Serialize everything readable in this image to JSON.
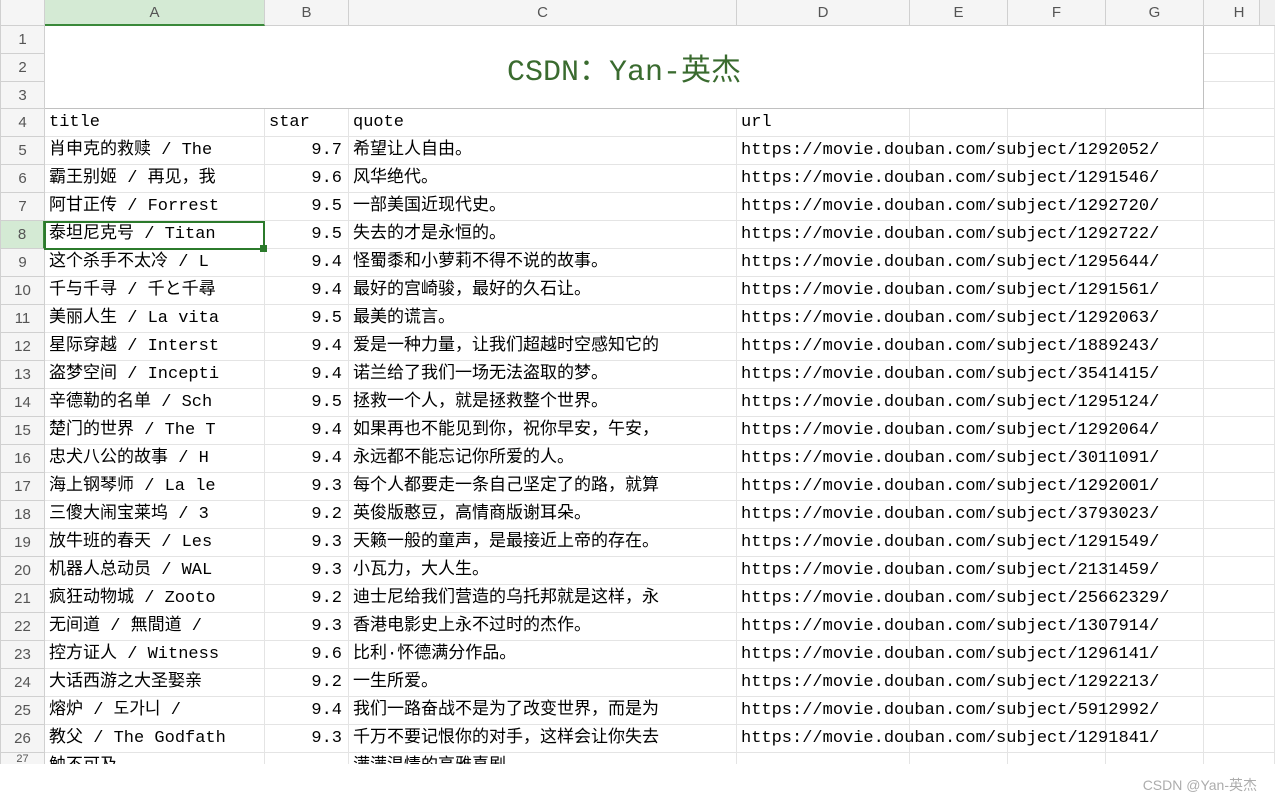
{
  "columns": [
    "A",
    "B",
    "C",
    "D",
    "E",
    "F",
    "G",
    "H"
  ],
  "title_cell": "CSDN：Yan-英杰",
  "header_row": {
    "A": "title",
    "B": "star",
    "C": "quote",
    "D": "url"
  },
  "selected_cell": "A8",
  "watermark": "CSDN @Yan-英杰",
  "chart_data": {
    "type": "table",
    "columns": [
      "title",
      "star",
      "quote",
      "url"
    ],
    "rows": [
      {
        "title": "肖申克的救赎  /  The",
        "star": 9.7,
        "quote": "希望让人自由。",
        "url": "https://movie.douban.com/subject/1292052/"
      },
      {
        "title": "霸王别姬  /  再见，我",
        "star": 9.6,
        "quote": "风华绝代。",
        "url": "https://movie.douban.com/subject/1291546/"
      },
      {
        "title": "阿甘正传  /  Forrest",
        "star": 9.5,
        "quote": "一部美国近现代史。",
        "url": "https://movie.douban.com/subject/1292720/"
      },
      {
        "title": "泰坦尼克号  /  Titan",
        "star": 9.5,
        "quote": "失去的才是永恒的。",
        "url": "https://movie.douban.com/subject/1292722/"
      },
      {
        "title": "这个杀手不太冷  /  L",
        "star": 9.4,
        "quote": "怪蜀黍和小萝莉不得不说的故事。",
        "url": "https://movie.douban.com/subject/1295644/"
      },
      {
        "title": "千与千寻  /  千と千尋",
        "star": 9.4,
        "quote": "最好的宫崎骏，最好的久石让。",
        "url": "https://movie.douban.com/subject/1291561/"
      },
      {
        "title": "美丽人生  /  La vita",
        "star": 9.5,
        "quote": "最美的谎言。",
        "url": "https://movie.douban.com/subject/1292063/"
      },
      {
        "title": "星际穿越  /  Interst",
        "star": 9.4,
        "quote": "爱是一种力量，让我们超越时空感知它的",
        "url": "https://movie.douban.com/subject/1889243/"
      },
      {
        "title": "盗梦空间  /  Incepti",
        "star": 9.4,
        "quote": "诺兰给了我们一场无法盗取的梦。",
        "url": "https://movie.douban.com/subject/3541415/"
      },
      {
        "title": "辛德勒的名单  /  Sch",
        "star": 9.5,
        "quote": "拯救一个人，就是拯救整个世界。",
        "url": "https://movie.douban.com/subject/1295124/"
      },
      {
        "title": "楚门的世界  /  The T",
        "star": 9.4,
        "quote": "如果再也不能见到你，祝你早安，午安，",
        "url": "https://movie.douban.com/subject/1292064/"
      },
      {
        "title": "忠犬八公的故事  /  H",
        "star": 9.4,
        "quote": "永远都不能忘记你所爱的人。",
        "url": "https://movie.douban.com/subject/3011091/"
      },
      {
        "title": "海上钢琴师  /  La le",
        "star": 9.3,
        "quote": "每个人都要走一条自己坚定了的路，就算",
        "url": "https://movie.douban.com/subject/1292001/"
      },
      {
        "title": "三傻大闹宝莱坞  /  3",
        "star": 9.2,
        "quote": "英俊版憨豆，高情商版谢耳朵。",
        "url": "https://movie.douban.com/subject/3793023/"
      },
      {
        "title": "放牛班的春天  /  Les",
        "star": 9.3,
        "quote": "天籁一般的童声，是最接近上帝的存在。",
        "url": "https://movie.douban.com/subject/1291549/"
      },
      {
        "title": "机器人总动员  /  WAL",
        "star": 9.3,
        "quote": "小瓦力，大人生。",
        "url": "https://movie.douban.com/subject/2131459/"
      },
      {
        "title": "疯狂动物城  /  Zooto",
        "star": 9.2,
        "quote": "迪士尼给我们营造的乌托邦就是这样，永",
        "url": "https://movie.douban.com/subject/25662329/"
      },
      {
        "title": "无间道  /  無間道  /",
        "star": 9.3,
        "quote": "香港电影史上永不过时的杰作。",
        "url": "https://movie.douban.com/subject/1307914/"
      },
      {
        "title": "控方证人  /  Witness",
        "star": 9.6,
        "quote": "比利·怀德满分作品。",
        "url": "https://movie.douban.com/subject/1296141/"
      },
      {
        "title": "大话西游之大圣娶亲",
        "star": 9.2,
        "quote": "一生所爱。",
        "url": "https://movie.douban.com/subject/1292213/"
      },
      {
        "title": "熔炉  /  도가니  /",
        "star": 9.4,
        "quote": "我们一路奋战不是为了改变世界，而是为",
        "url": "https://movie.douban.com/subject/5912992/"
      },
      {
        "title": "教父  /  The Godfath",
        "star": 9.3,
        "quote": "千万不要记恨你的对手，这样会让你失去",
        "url": "https://movie.douban.com/subject/1291841/"
      }
    ],
    "partial_last_row": {
      "title": "触不可及",
      "quote": "满满温情的高雅喜剧"
    }
  }
}
